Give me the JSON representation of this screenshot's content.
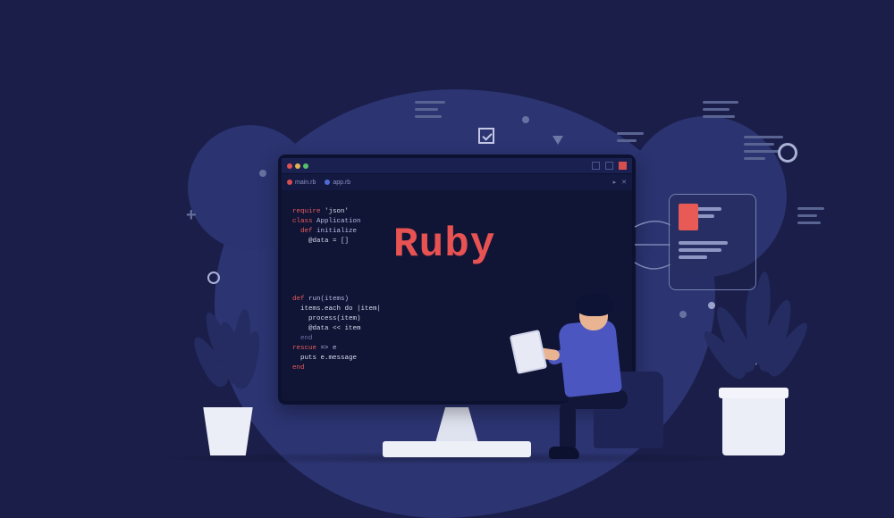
{
  "brand": "Ruby",
  "tabs": {
    "file1": "main.rb",
    "file2": "app.rb",
    "right1": "▸",
    "right2": "✕"
  },
  "code": {
    "l1a": "require",
    "l1b": " 'json'",
    "l2a": "class",
    "l2b": " Application",
    "l3a": "  def",
    "l3b": " initialize",
    "l4": "    @data = []",
    "l5a": "def",
    "l5b": " run(items)",
    "l6": "  items.each do |item|",
    "l7": "    process(item)",
    "l8": "    @data << item",
    "l9": "  end",
    "l10a": "rescue",
    "l10b": " => e",
    "l11": "  puts e.message",
    "l12a": "end"
  }
}
